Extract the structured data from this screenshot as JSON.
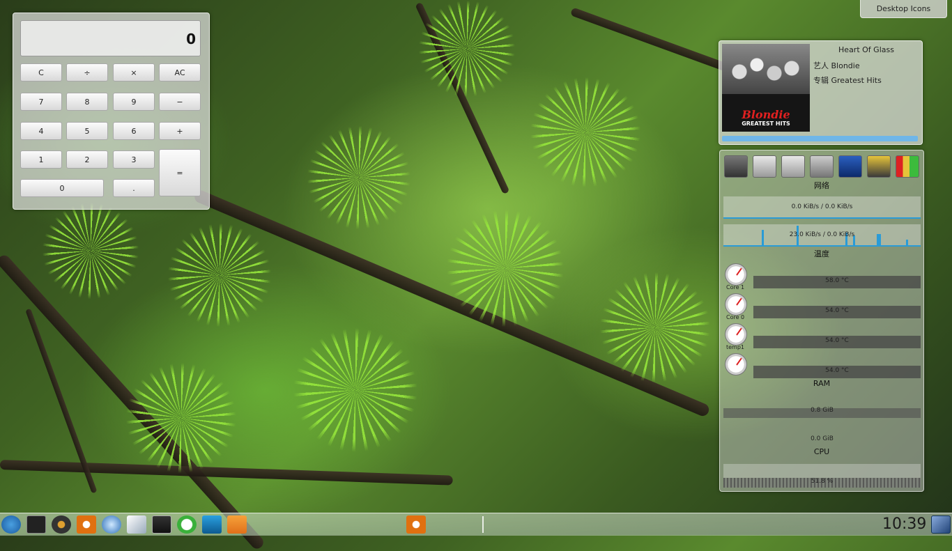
{
  "desktop": {
    "icons_button_label": "Desktop Icons"
  },
  "calculator": {
    "display": "0",
    "buttons": {
      "clear": "C",
      "divide": "÷",
      "multiply": "×",
      "all_clear": "AC",
      "seven": "7",
      "eight": "8",
      "nine": "9",
      "minus": "−",
      "four": "4",
      "five": "5",
      "six": "6",
      "plus": "+",
      "one": "1",
      "two": "2",
      "three": "3",
      "equals": "=",
      "zero": "0",
      "decimal": "."
    }
  },
  "now_playing": {
    "title": "Heart Of Glass",
    "artist_label": "艺人",
    "artist": "Blondie",
    "album_label": "专辑",
    "album": "Greatest Hits",
    "cover_band": "Blondie",
    "cover_subtitle": "GREATEST HITS"
  },
  "system_monitor": {
    "network": {
      "title": "网络",
      "iface1": "0.0 KiB/s / 0.0 KiB/s",
      "iface2": "23.0 KiB/s / 0.0 KiB/s"
    },
    "temperature": {
      "title": "温度",
      "sensors": [
        {
          "name": "Core 1",
          "value": "58.0 °C"
        },
        {
          "name": "Core 0",
          "value": "54.0 °C"
        },
        {
          "name": "temp1",
          "value": "54.0 °C"
        },
        {
          "name": "",
          "value": "54.0 °C"
        }
      ]
    },
    "ram": {
      "title": "RAM",
      "used": "0.8 GiB",
      "swap": "0.0 GiB"
    },
    "cpu": {
      "title": "CPU",
      "value": "51.8 %"
    }
  },
  "taskbar": {
    "clock": "10:39"
  }
}
